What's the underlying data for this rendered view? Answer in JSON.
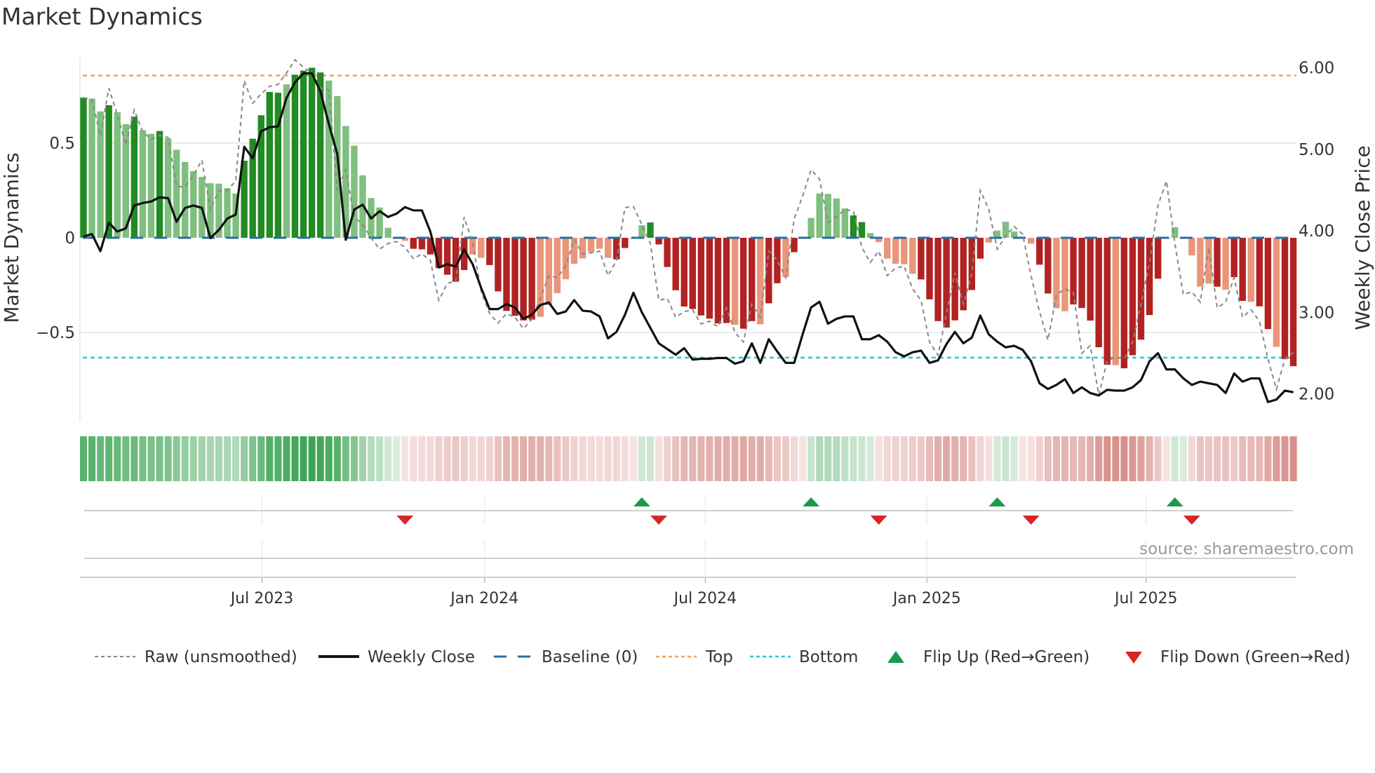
{
  "title": "Market Dynamics",
  "source": "source: sharemaestro.com",
  "legend": {
    "raw": "Raw (unsmoothed)",
    "close": "Weekly Close",
    "baseline": "Baseline (0)",
    "top": "Top",
    "bottom": "Bottom",
    "flip_up": "Flip Up (Red→Green)",
    "flip_down": "Flip Down (Green→Red)"
  },
  "colors": {
    "dark_green": "#228b22",
    "light_green": "#7fbf7f",
    "dark_red": "#b22222",
    "light_red": "#e9967a",
    "baseline": "#2a6e9e",
    "top": "#f0a35e",
    "bottom": "#2ec4d6",
    "flip_up": "#1a9a47",
    "flip_down": "#d62728",
    "raw": "#888888",
    "close": "#111111"
  },
  "chart_data": {
    "type": "bar+line",
    "title": "Market Dynamics",
    "ylabel": "Market Dynamics",
    "y2label": "Weekly Close Price",
    "ylim": [
      -0.98,
      0.96
    ],
    "y2lim": [
      1.8,
      6.2
    ],
    "yticks": [
      {
        "v": 0.5,
        "label": "0.5"
      },
      {
        "v": 0,
        "label": "0"
      },
      {
        "v": -0.5,
        "label": "−0.5"
      }
    ],
    "y2ticks": [
      {
        "v": 6,
        "label": "6.00"
      },
      {
        "v": 5,
        "label": "5.00"
      },
      {
        "v": 4,
        "label": "4.00"
      },
      {
        "v": 3,
        "label": "3.00"
      },
      {
        "v": 2,
        "label": "2.00"
      }
    ],
    "xticks": [
      {
        "label": "Jul 2023",
        "week": 21.1
      },
      {
        "label": "Jan 2024",
        "week": 47.4
      },
      {
        "label": "Jul 2024",
        "week": 73.5
      },
      {
        "label": "Jan 2025",
        "week": 99.7
      },
      {
        "label": "Jul 2025",
        "week": 125.6
      }
    ],
    "top_level": 0.857,
    "bottom_level": -0.633,
    "baseline": 0,
    "values": [
      0.74,
      0.735,
      0.667,
      0.7,
      0.663,
      0.6,
      0.64,
      0.568,
      0.549,
      0.564,
      0.525,
      0.465,
      0.4,
      0.352,
      0.322,
      0.288,
      0.286,
      0.262,
      0.234,
      0.407,
      0.523,
      0.647,
      0.77,
      0.766,
      0.81,
      0.861,
      0.883,
      0.898,
      0.873,
      0.83,
      0.748,
      0.59,
      0.486,
      0.33,
      0.21,
      0.16,
      0.053,
      0.005,
      -0.016,
      -0.058,
      -0.061,
      -0.088,
      -0.16,
      -0.195,
      -0.232,
      -0.17,
      -0.088,
      -0.106,
      -0.144,
      -0.283,
      -0.386,
      -0.412,
      -0.436,
      -0.432,
      -0.417,
      -0.355,
      -0.292,
      -0.219,
      -0.137,
      -0.109,
      -0.076,
      -0.058,
      -0.106,
      -0.114,
      -0.054,
      -0.005,
      0.066,
      0.081,
      -0.035,
      -0.154,
      -0.277,
      -0.363,
      -0.376,
      -0.41,
      -0.427,
      -0.452,
      -0.45,
      -0.46,
      -0.48,
      -0.44,
      -0.457,
      -0.346,
      -0.24,
      -0.207,
      -0.076,
      -0.004,
      0.105,
      0.234,
      0.232,
      0.207,
      0.155,
      0.118,
      0.083,
      0.025,
      -0.023,
      -0.11,
      -0.137,
      -0.14,
      -0.19,
      -0.22,
      -0.325,
      -0.44,
      -0.474,
      -0.436,
      -0.383,
      -0.276,
      -0.11,
      -0.025,
      0.038,
      0.085,
      0.034,
      -0.005,
      -0.031,
      -0.142,
      -0.294,
      -0.372,
      -0.388,
      -0.352,
      -0.371,
      -0.437,
      -0.578,
      -0.67,
      -0.672,
      -0.689,
      -0.62,
      -0.538,
      -0.408,
      -0.216,
      -0.003,
      0.056,
      0.005,
      -0.093,
      -0.258,
      -0.242,
      -0.258,
      -0.274,
      -0.208,
      -0.333,
      -0.338,
      -0.362,
      -0.482,
      -0.576,
      -0.64,
      -0.678
    ],
    "shades": "dlldlldlldllllllllldddddlddddlllllllllldddddddllddddddlllllllllddllddddddddddlddlddlddlllllddllllllddddddddllllllddlldddddlddddddllllldlddlddlddddddd",
    "raw": [
      0.74,
      0.73,
      0.54,
      0.79,
      0.65,
      0.49,
      0.675,
      0.56,
      0.52,
      0.54,
      0.53,
      0.27,
      0.27,
      0.33,
      0.41,
      0.15,
      0.25,
      0.25,
      0.3,
      0.83,
      0.71,
      0.76,
      0.8,
      0.81,
      0.87,
      0.94,
      0.9,
      0.87,
      0.79,
      0.78,
      0.25,
      0.36,
      0.11,
      0.07,
      0.0,
      -0.06,
      -0.03,
      -0.02,
      -0.05,
      -0.11,
      -0.085,
      -0.12,
      -0.33,
      -0.24,
      -0.23,
      0.11,
      -0.03,
      -0.28,
      -0.4,
      -0.45,
      -0.4,
      -0.42,
      -0.48,
      -0.43,
      -0.32,
      -0.2,
      -0.21,
      -0.15,
      -0.01,
      -0.085,
      -0.08,
      -0.07,
      -0.2,
      -0.12,
      0.16,
      0.165,
      0.07,
      -0.03,
      -0.33,
      -0.32,
      -0.42,
      -0.39,
      -0.38,
      -0.455,
      -0.44,
      -0.47,
      -0.37,
      -0.5,
      -0.55,
      -0.35,
      -0.42,
      -0.07,
      -0.12,
      -0.21,
      0.1,
      0.22,
      0.36,
      0.31,
      0.08,
      0.11,
      0.15,
      0.14,
      -0.05,
      -0.13,
      -0.07,
      -0.2,
      -0.16,
      -0.15,
      -0.27,
      -0.33,
      -0.55,
      -0.62,
      -0.4,
      -0.185,
      -0.35,
      -0.19,
      0.25,
      0.15,
      -0.06,
      0.01,
      0.06,
      0.02,
      -0.2,
      -0.39,
      -0.54,
      -0.3,
      -0.27,
      -0.29,
      -0.61,
      -0.57,
      -0.83,
      -0.65,
      -0.63,
      -0.64,
      -0.55,
      -0.35,
      -0.13,
      0.17,
      0.3,
      -0.03,
      -0.3,
      -0.285,
      -0.34,
      -0.05,
      -0.37,
      -0.34,
      -0.21,
      -0.42,
      -0.38,
      -0.44,
      -0.64,
      -0.8,
      -0.64,
      -0.605
    ],
    "close": [
      3.93,
      3.96,
      3.75,
      4.1,
      3.99,
      4.03,
      4.31,
      4.34,
      4.36,
      4.41,
      4.4,
      4.11,
      4.28,
      4.31,
      4.28,
      3.91,
      4.01,
      4.15,
      4.2,
      5.03,
      4.89,
      5.22,
      5.27,
      5.28,
      5.63,
      5.82,
      5.93,
      5.93,
      5.71,
      5.31,
      4.94,
      3.89,
      4.26,
      4.32,
      4.15,
      4.24,
      4.17,
      4.21,
      4.29,
      4.25,
      4.25,
      3.99,
      3.55,
      3.59,
      3.56,
      3.77,
      3.59,
      3.3,
      3.04,
      3.04,
      3.1,
      3.06,
      2.92,
      2.97,
      3.09,
      3.12,
      2.98,
      3.01,
      3.15,
      3.02,
      3.01,
      2.95,
      2.68,
      2.76,
      2.97,
      3.24,
      3.0,
      2.81,
      2.62,
      2.55,
      2.48,
      2.56,
      2.42,
      2.43,
      2.43,
      2.44,
      2.44,
      2.37,
      2.4,
      2.62,
      2.38,
      2.67,
      2.52,
      2.38,
      2.38,
      2.73,
      3.06,
      3.13,
      2.86,
      2.92,
      2.95,
      2.95,
      2.67,
      2.67,
      2.72,
      2.64,
      2.51,
      2.46,
      2.51,
      2.53,
      2.38,
      2.41,
      2.61,
      2.76,
      2.62,
      2.69,
      2.96,
      2.73,
      2.64,
      2.57,
      2.59,
      2.54,
      2.4,
      2.13,
      2.06,
      2.11,
      2.18,
      2.01,
      2.08,
      2.01,
      1.98,
      2.05,
      2.04,
      2.04,
      2.08,
      2.17,
      2.4,
      2.5,
      2.3,
      2.3,
      2.19,
      2.11,
      2.15,
      2.13,
      2.11,
      2.01,
      2.25,
      2.15,
      2.19,
      2.19,
      1.9,
      1.93,
      2.04,
      2.02
    ],
    "flips": [
      {
        "week": 38,
        "dir": "down"
      },
      {
        "week": 66,
        "dir": "up"
      },
      {
        "week": 68,
        "dir": "down"
      },
      {
        "week": 86,
        "dir": "up"
      },
      {
        "week": 94,
        "dir": "down"
      },
      {
        "week": 108,
        "dir": "up"
      },
      {
        "week": 112,
        "dir": "down"
      },
      {
        "week": 129,
        "dir": "up"
      },
      {
        "week": 131,
        "dir": "down"
      }
    ],
    "legend_placement": "bottom"
  }
}
